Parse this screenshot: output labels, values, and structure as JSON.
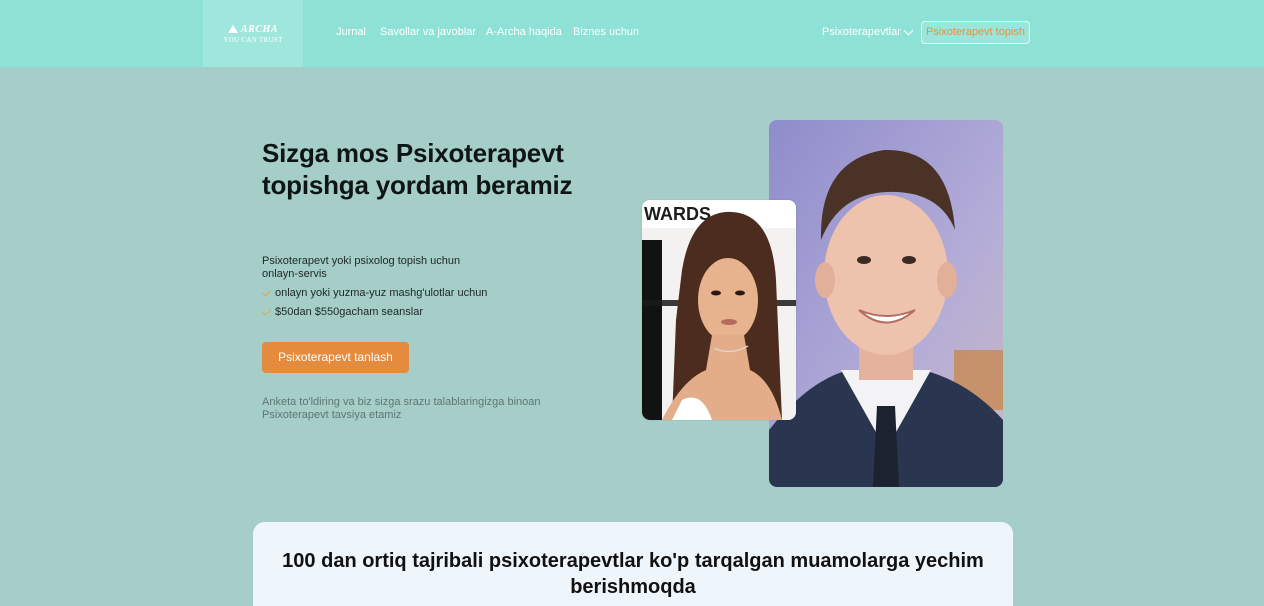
{
  "header": {
    "logo": {
      "brand": "ARCHA",
      "tagline": "YOU CAN TRUST"
    },
    "nav": [
      "Jurnal",
      "Savollar va javoblar",
      "A-Archa haqida",
      "Biznes uchun"
    ],
    "dropdown_label": "Psixoterapevtlar",
    "find_button_label": "Psixoterapevt topish"
  },
  "hero": {
    "title": "Sizga mos Psixoterapevt topishga yordam beramiz",
    "description": "Psixoterapevt yoki psixolog topish uchun onlayn-servis",
    "features": [
      "onlayn yoki yuzma-yuz mashg'ulotlar uchun",
      "$50dan $550gacham seanslar"
    ],
    "cta_label": "Psixoterapevt tanlash",
    "note": "Anketa to'ldiring va biz sizga srazu talablaringizga binoan Psixoterapevt tavsiya etamiz"
  },
  "photos": {
    "small_backdrop_text": "WARDS"
  },
  "stats_card": {
    "title": "100 dan ortiq tajribali psixoterapevtlar ko'p tarqalgan muamolarga yechim berishmoqda"
  },
  "colors": {
    "header_bg": "#8de2d5",
    "page_bg": "#a6cec8",
    "accent_orange": "#e58b3e",
    "card_bg": "#eff6fb"
  },
  "icons": [
    "chevron-down-icon",
    "check-icon",
    "logo-triangle-icon"
  ]
}
